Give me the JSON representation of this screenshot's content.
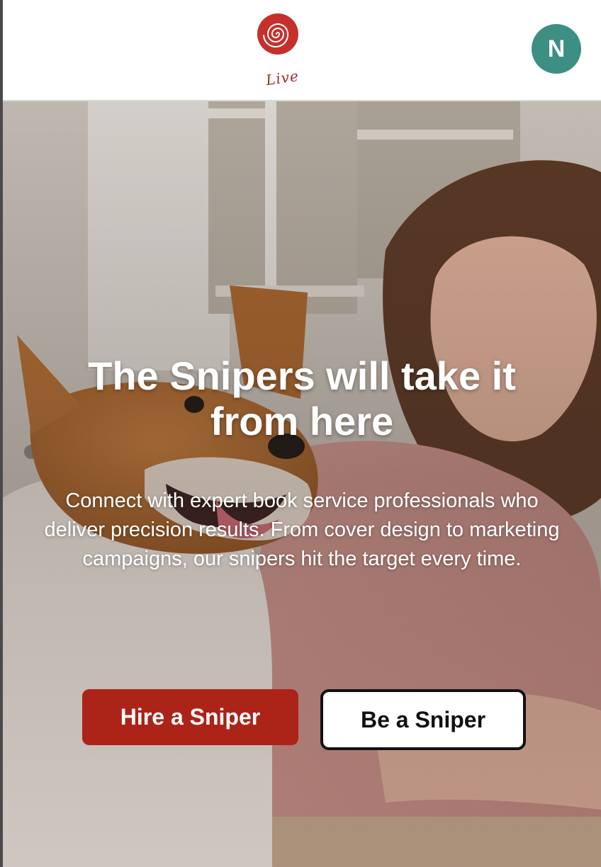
{
  "header": {
    "logo_text": "Live",
    "avatar_initial": "N"
  },
  "hero": {
    "title": "The Snipers will take it from here",
    "subtitle": "Connect with expert book service professionals who deliver precision results. From cover design to marketing campaigns, our snipers hit the target every time.",
    "primary_button": "Hire a Sniper",
    "secondary_button": "Be a Sniper",
    "background_image": "photo of a smiling woman with a corgi dog in a kitchen"
  },
  "colors": {
    "brand_red": "#ac2318",
    "logo_red": "#c7302a",
    "avatar_teal": "#3d8f83",
    "text_white": "#ffffff",
    "button_border": "#111111"
  }
}
